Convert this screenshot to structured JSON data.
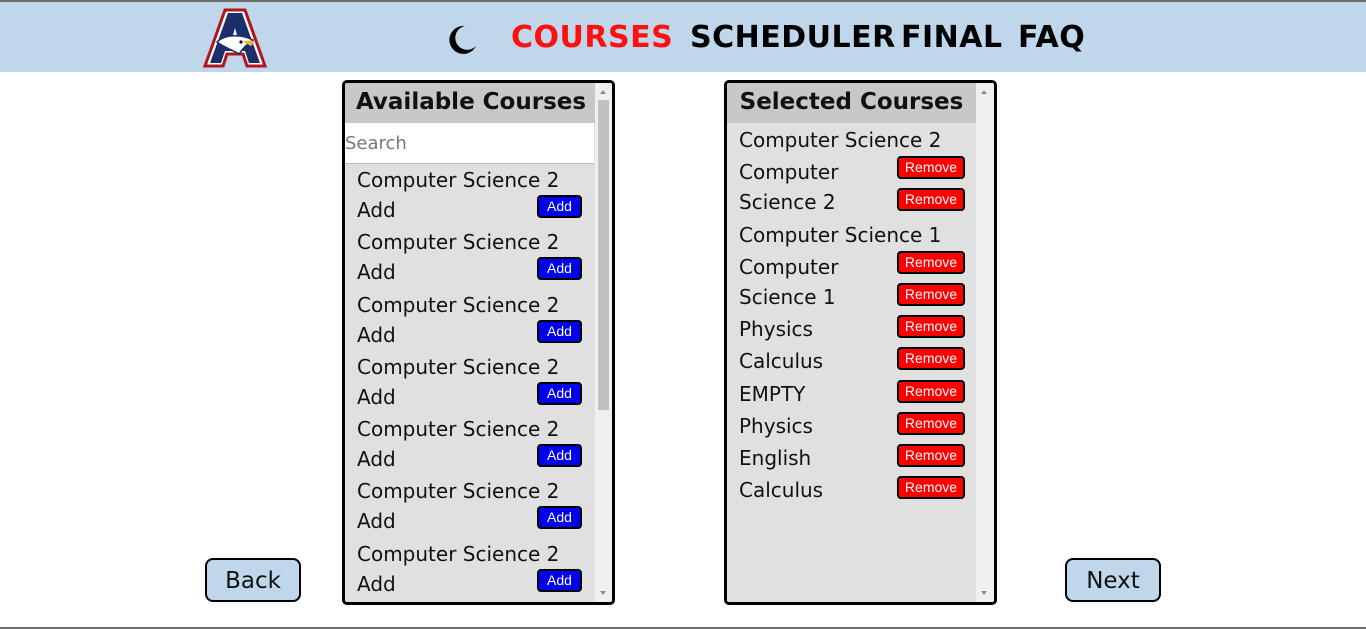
{
  "header": {
    "logo_letter": "A",
    "theme_icon": "moon-icon",
    "nav": [
      {
        "label": "COURSES",
        "active": true
      },
      {
        "label": "SCHEDULER",
        "active": false
      },
      {
        "label": "FINAL",
        "active": false
      },
      {
        "label": "FAQ",
        "active": false
      }
    ],
    "colors": {
      "background": "#c0d6ea",
      "active_link": "#ff1010"
    }
  },
  "available": {
    "title": "Available Courses",
    "search_placeholder": "Search",
    "items": [
      {
        "name": "Computer Science 2",
        "action_text": "Add",
        "button": "Add"
      },
      {
        "name": "Computer Science 2",
        "action_text": "Add",
        "button": "Add"
      },
      {
        "name": "Computer Science 2",
        "action_text": "Add",
        "button": "Add"
      },
      {
        "name": "Computer Science 2",
        "action_text": "Add",
        "button": "Add"
      },
      {
        "name": "Computer Science 2",
        "action_text": "Add",
        "button": "Add"
      },
      {
        "name": "Computer Science 2",
        "action_text": "Add",
        "button": "Add"
      },
      {
        "name": "Computer Science 2",
        "action_text": "Add",
        "button": "Add"
      }
    ],
    "add_button_color": "#0000ee"
  },
  "selected": {
    "title": "Selected Courses",
    "lines": [
      {
        "text": "Computer Science 2",
        "button": null
      },
      {
        "text": "Computer",
        "button": "Remove"
      },
      {
        "text": "Science 2",
        "button": "Remove"
      },
      {
        "text": "Computer Science 1",
        "button": null
      },
      {
        "text": "Computer",
        "button": "Remove"
      },
      {
        "text": "Science 1",
        "button": "Remove"
      },
      {
        "text": "Physics",
        "button": "Remove"
      },
      {
        "text": "Calculus",
        "button": "Remove"
      },
      {
        "text": "EMPTY",
        "button": "Remove"
      },
      {
        "text": "Physics",
        "button": "Remove"
      },
      {
        "text": "English",
        "button": "Remove"
      },
      {
        "text": "Calculus",
        "button": "Remove"
      }
    ],
    "remove_button_color": "#ff0000"
  },
  "footer": {
    "back_label": "Back",
    "next_label": "Next"
  }
}
